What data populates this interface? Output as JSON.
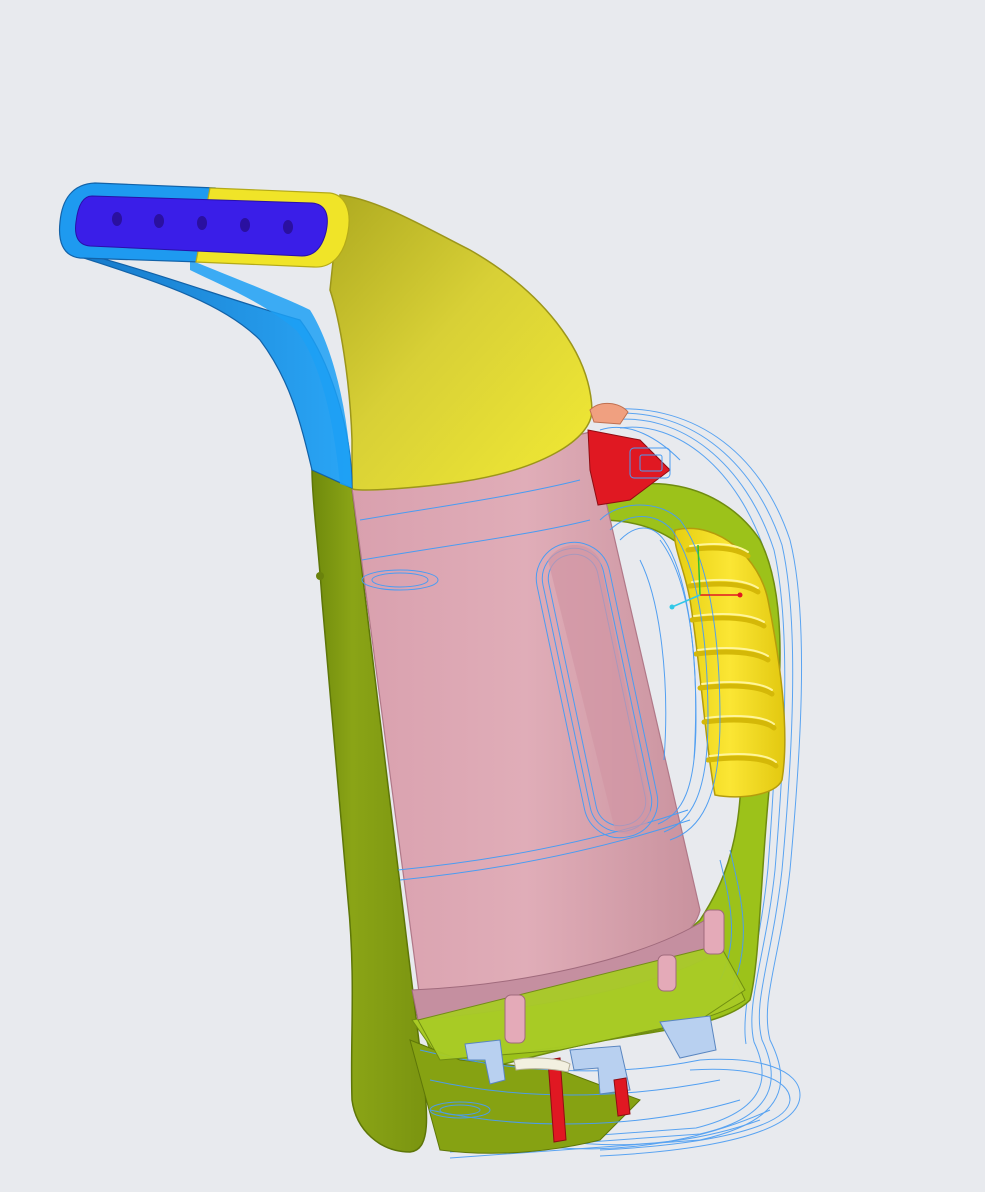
{
  "scene": {
    "subject": "handheld-garment-steamer-cad-model",
    "colors": {
      "background": "#e8eaee",
      "nozzle_blue": "#1e9af0",
      "nozzle_face": "#3a1ee8",
      "nozzle_yellow": "#f0e428",
      "head_yellow": "#d8d036",
      "body_green": "#8aa416",
      "tank_pink": "#dca6b2",
      "grip_yellow": "#f6e22a",
      "frame_green": "#9cc21a",
      "wireframe_blue": "#4a9cf2",
      "switch_red": "#e01822",
      "part_lightblue": "#b8d0f0"
    },
    "nozzle_hole_count": 5,
    "grip_rib_count": 7
  }
}
